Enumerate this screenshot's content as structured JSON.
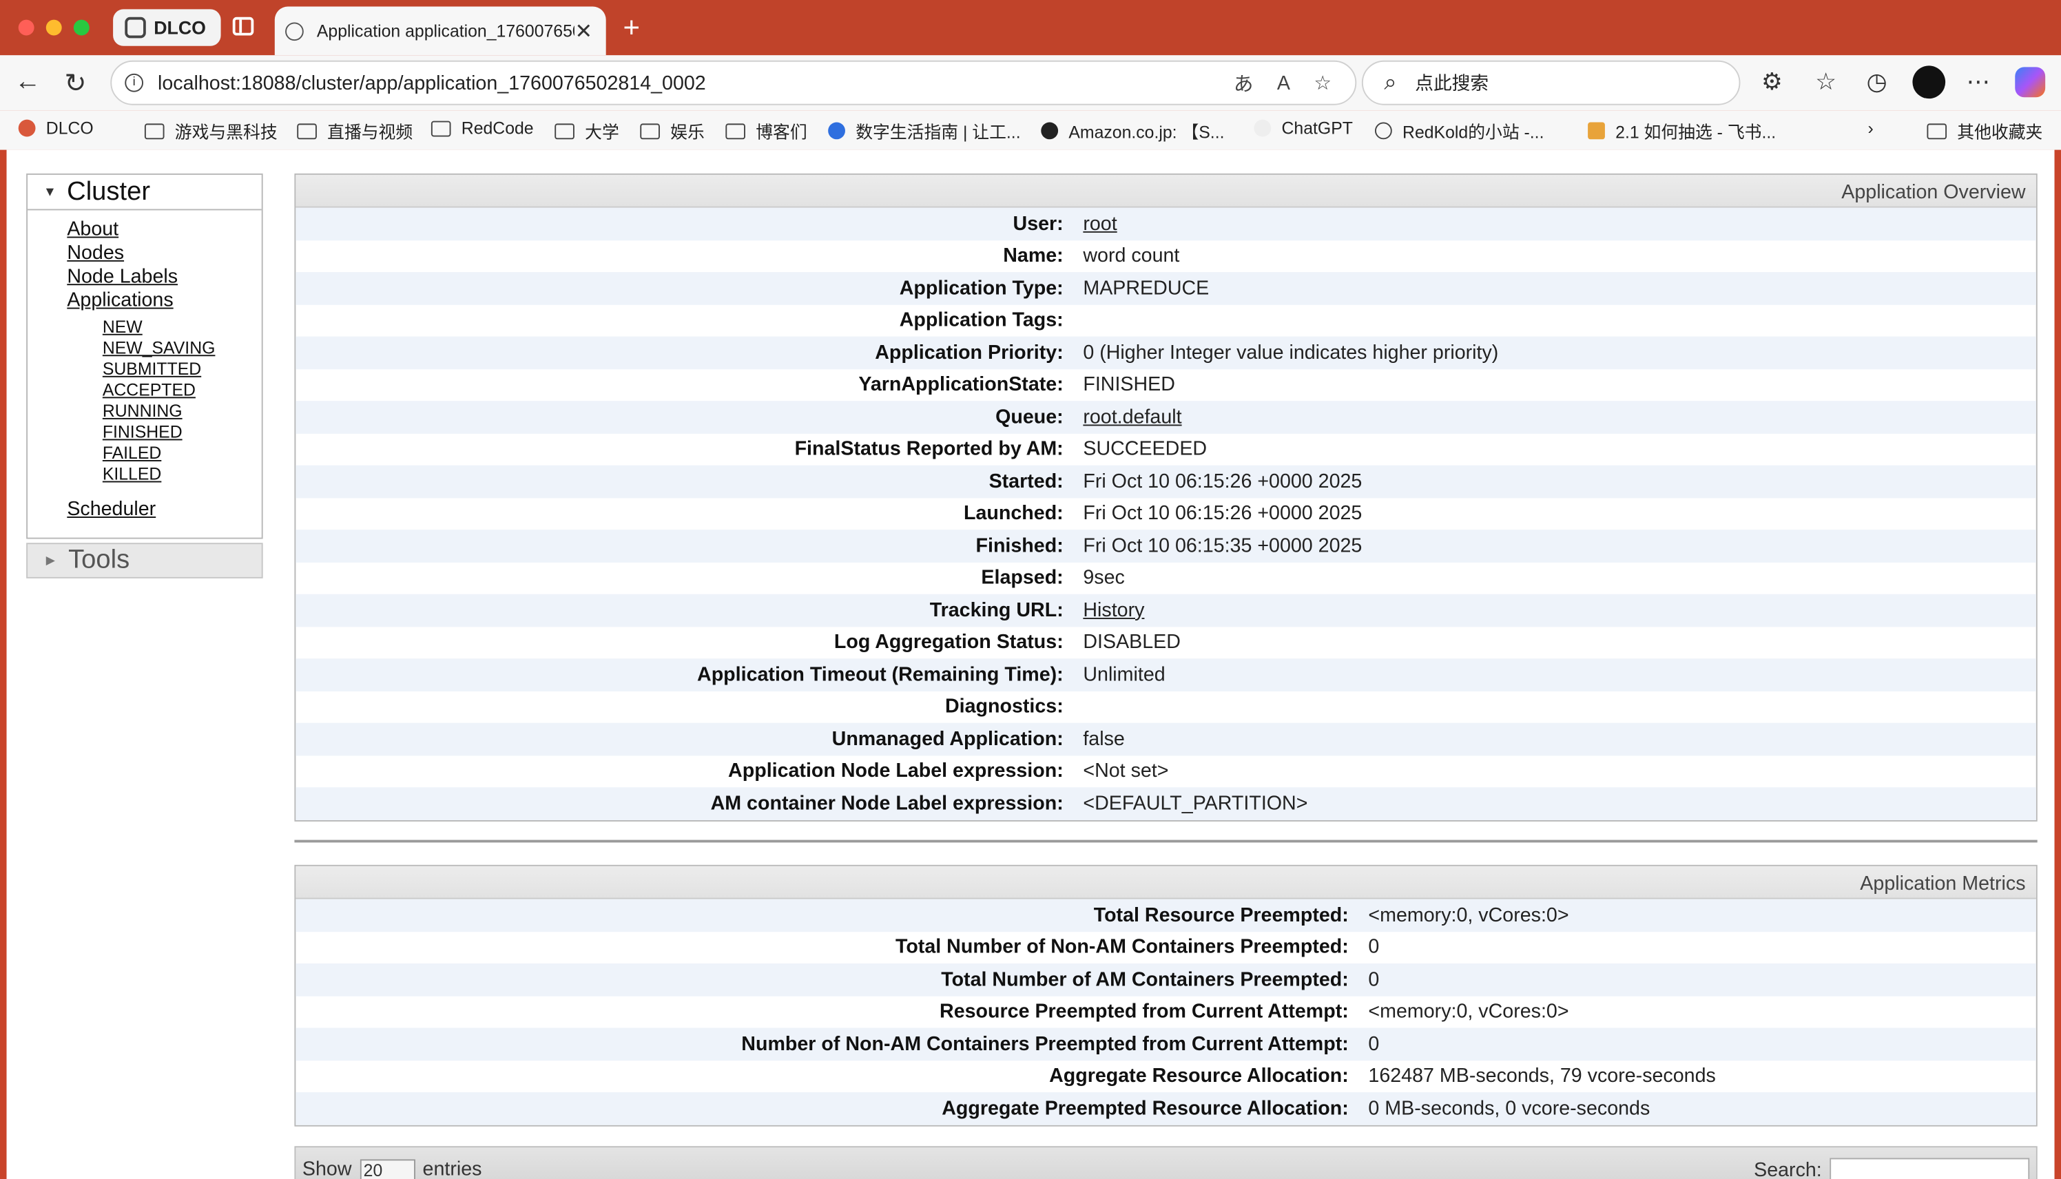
{
  "browser": {
    "profile_label": "DLCO",
    "tab_title": "Application application_1760076502814_0002",
    "url": "localhost:18088/cluster/app/application_1760076502814_0002",
    "search_placeholder": "点此搜索",
    "bookmarks": [
      "DLCO",
      "游戏与黑科技",
      "直播与视频",
      "RedCode",
      "大学",
      "娱乐",
      "博客们",
      "数字生活指南 | 让工...",
      "Amazon.co.jp: 【S...",
      "ChatGPT",
      "RedKold的小站 -...",
      "2.1 如何抽选 - 飞书...",
      "其他收藏夹"
    ]
  },
  "sidebar": {
    "cluster_title": "Cluster",
    "links": [
      "About",
      "Nodes",
      "Node Labels",
      "Applications"
    ],
    "states": [
      "NEW",
      "NEW_SAVING",
      "SUBMITTED",
      "ACCEPTED",
      "RUNNING",
      "FINISHED",
      "FAILED",
      "KILLED"
    ],
    "scheduler": "Scheduler",
    "tools_title": "Tools"
  },
  "overview": {
    "title": "Application Overview",
    "rows": [
      {
        "k": "User:",
        "v": "root"
      },
      {
        "k": "Name:",
        "v": "word count"
      },
      {
        "k": "Application Type:",
        "v": "MAPREDUCE"
      },
      {
        "k": "Application Tags:",
        "v": ""
      },
      {
        "k": "Application Priority:",
        "v": "0 (Higher Integer value indicates higher priority)"
      },
      {
        "k": "YarnApplicationState:",
        "v": "FINISHED"
      },
      {
        "k": "Queue:",
        "v": "root.default"
      },
      {
        "k": "FinalStatus Reported by AM:",
        "v": "SUCCEEDED"
      },
      {
        "k": "Started:",
        "v": "Fri Oct 10 06:15:26 +0000 2025"
      },
      {
        "k": "Launched:",
        "v": "Fri Oct 10 06:15:26 +0000 2025"
      },
      {
        "k": "Finished:",
        "v": "Fri Oct 10 06:15:35 +0000 2025"
      },
      {
        "k": "Elapsed:",
        "v": "9sec"
      },
      {
        "k": "Tracking URL:",
        "v": "History"
      },
      {
        "k": "Log Aggregation Status:",
        "v": "DISABLED"
      },
      {
        "k": "Application Timeout (Remaining Time):",
        "v": "Unlimited"
      },
      {
        "k": "Diagnostics:",
        "v": ""
      },
      {
        "k": "Unmanaged Application:",
        "v": "false"
      },
      {
        "k": "Application Node Label expression:",
        "v": "<Not set>"
      },
      {
        "k": "AM container Node Label expression:",
        "v": "<DEFAULT_PARTITION>"
      }
    ]
  },
  "metrics": {
    "title": "Application Metrics",
    "rows": [
      {
        "k": "Total Resource Preempted:",
        "v": "<memory:0, vCores:0>"
      },
      {
        "k": "Total Number of Non-AM Containers Preempted:",
        "v": "0"
      },
      {
        "k": "Total Number of AM Containers Preempted:",
        "v": "0"
      },
      {
        "k": "Resource Preempted from Current Attempt:",
        "v": "<memory:0, vCores:0>"
      },
      {
        "k": "Number of Non-AM Containers Preempted from Current Attempt:",
        "v": "0"
      },
      {
        "k": "Aggregate Resource Allocation:",
        "v": "162487 MB-seconds, 79 vcore-seconds"
      },
      {
        "k": "Aggregate Preempted Resource Allocation:",
        "v": "0 MB-seconds, 0 vcore-seconds"
      }
    ]
  },
  "table_controls": {
    "show_label": "Show",
    "page_size": "20",
    "entries_label": "entries",
    "search_label": "Search:"
  }
}
